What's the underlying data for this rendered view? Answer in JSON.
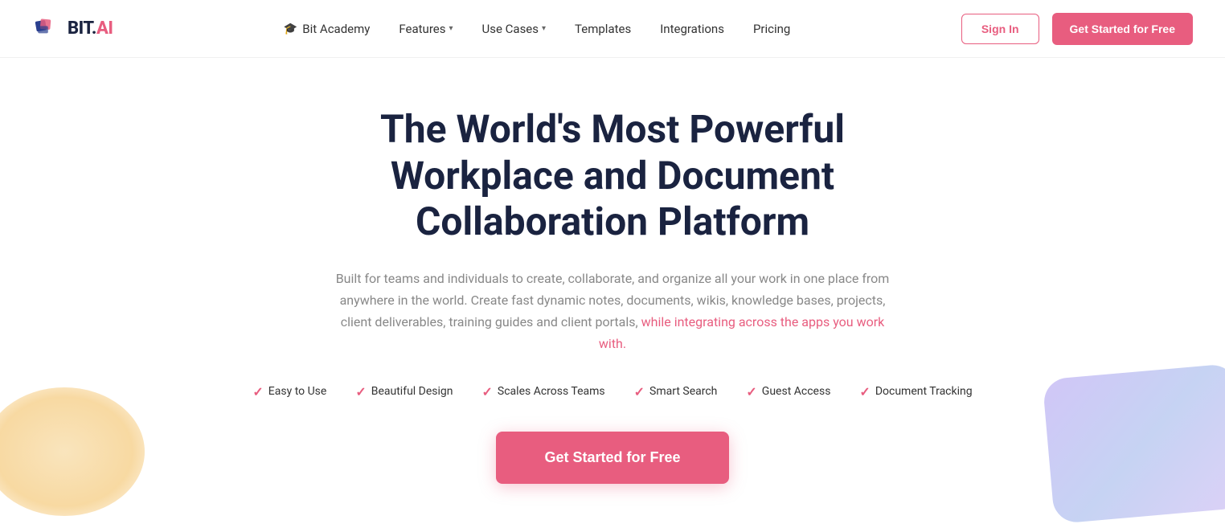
{
  "logo": {
    "text_bit": "BIT",
    "text_dot": ".",
    "text_ai": "AI"
  },
  "navbar": {
    "academy_label": "Bit Academy",
    "features_label": "Features",
    "use_cases_label": "Use Cases",
    "templates_label": "Templates",
    "integrations_label": "Integrations",
    "pricing_label": "Pricing",
    "signin_label": "Sign In",
    "get_started_label": "Get Started for Free"
  },
  "hero": {
    "title_line1": "The World's Most Powerful",
    "title_line2": "Workplace and Document Collaboration Platform",
    "subtitle": "Built for teams and individuals to create, collaborate, and organize all your work in one place from anywhere in the world. Create fast dynamic notes, documents, wikis, knowledge bases, projects, client deliverables, training guides and client portals, while integrating across the apps you work with.",
    "features": [
      {
        "label": "Easy to Use"
      },
      {
        "label": "Beautiful Design"
      },
      {
        "label": "Scales Across Teams"
      },
      {
        "label": "Smart Search"
      },
      {
        "label": "Guest Access"
      },
      {
        "label": "Document Tracking"
      }
    ],
    "cta_label": "Get Started for Free"
  },
  "colors": {
    "accent": "#e85d7f",
    "text_dark": "#1a2340",
    "text_muted": "#888",
    "text_highlight": "#e85d7f"
  }
}
